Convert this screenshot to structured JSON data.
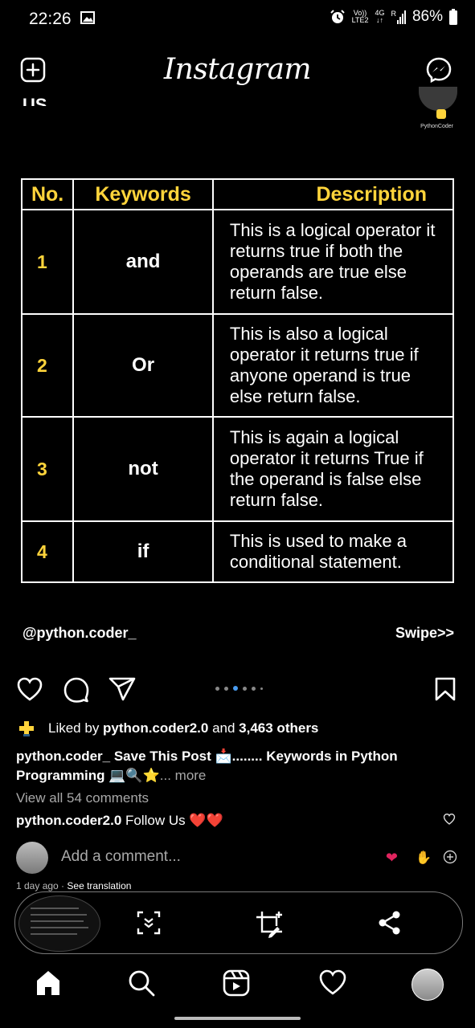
{
  "status": {
    "time": "22:26",
    "volte_top": "Vo))",
    "volte_bottom": "LTE2",
    "net_top": "4G",
    "net_bottom": "↓↑",
    "roaming": "R",
    "battery": "86%"
  },
  "header": {
    "logo": "Instagram",
    "icons": [
      "add-icon",
      "messenger-icon"
    ]
  },
  "post": {
    "cut_text": "US",
    "badge_label": "PythonCoder",
    "table": {
      "headers": [
        "No.",
        "Keywords",
        "Description"
      ],
      "rows": [
        {
          "no": "1",
          "keyword": "and",
          "description": "This is a logical operator it returns true if both the operands are true else return false."
        },
        {
          "no": "2",
          "keyword": "Or",
          "description": "This is also a logical operator it returns true if anyone operand is true else return false."
        },
        {
          "no": "3",
          "keyword": "not",
          "description": "This is again a logical operator it returns True if the operand is false else return false."
        },
        {
          "no": "4",
          "keyword": "if",
          "description": "This is used to make a conditional statement."
        }
      ]
    },
    "handle": "@python.coder_",
    "swipe": "Swipe>>"
  },
  "colors": {
    "accent": "#ffd43b",
    "active_dot": "#4a9cf0",
    "muted": "#a8a8a8",
    "heart": "#e0245e"
  },
  "engagement": {
    "liked_prefix": "Liked by ",
    "liked_user": "python.coder2.0",
    "liked_and": " and ",
    "liked_others": "3,463 others",
    "caption_user": "python.coder_",
    "caption_text_1": " Save This Post 📩........ ",
    "caption_text_bold": "Keywords in Python Programming",
    "caption_emoji": " 💻🔍⭐",
    "caption_more": "... more",
    "view_comments": "View all 54 comments",
    "comment_user": "python.coder2.0",
    "comment_text": " Follow Us ❤️❤️",
    "add_comment_placeholder": "Add a comment...",
    "time_ago": "1 day ago",
    "see_translation": "See translation"
  }
}
